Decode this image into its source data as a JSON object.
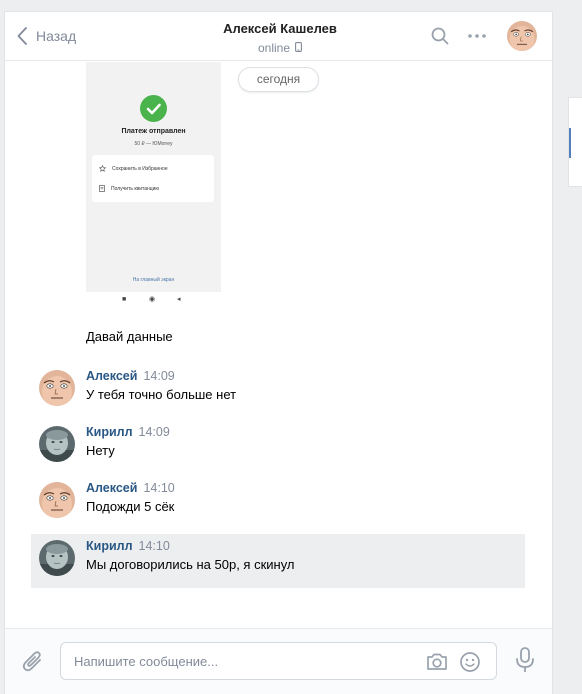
{
  "header": {
    "back_label": "Назад",
    "contact_name": "Алексей Кашелев",
    "status": "online"
  },
  "history": {
    "date_divider": "сегодня",
    "attachment": {
      "title": "Платеж отправлен",
      "subtitle": "50 ₽ — ЮMoney",
      "action_save": "Сохранить в Избранное",
      "action_receipt": "Получить квитанцию",
      "home_link": "На главный экран"
    },
    "continuation_text": "Давай данные",
    "messages": [
      {
        "author": "Алексей",
        "time": "14:09",
        "text": "У тебя точно больше нет"
      },
      {
        "author": "Кирилл",
        "time": "14:09",
        "text": "Нету"
      },
      {
        "author": "Алексей",
        "time": "14:10",
        "text": "Подожди 5 сёк"
      },
      {
        "author": "Кирилл",
        "time": "14:10",
        "text": "Мы договорились на 50р, я скинул"
      }
    ]
  },
  "composer": {
    "placeholder": "Напишите сообщение..."
  },
  "colors": {
    "link": "#2a5885",
    "muted": "#828a99",
    "accent": "#5181b8",
    "success": "#4bb34b",
    "highlight_bg": "#edeef0"
  }
}
